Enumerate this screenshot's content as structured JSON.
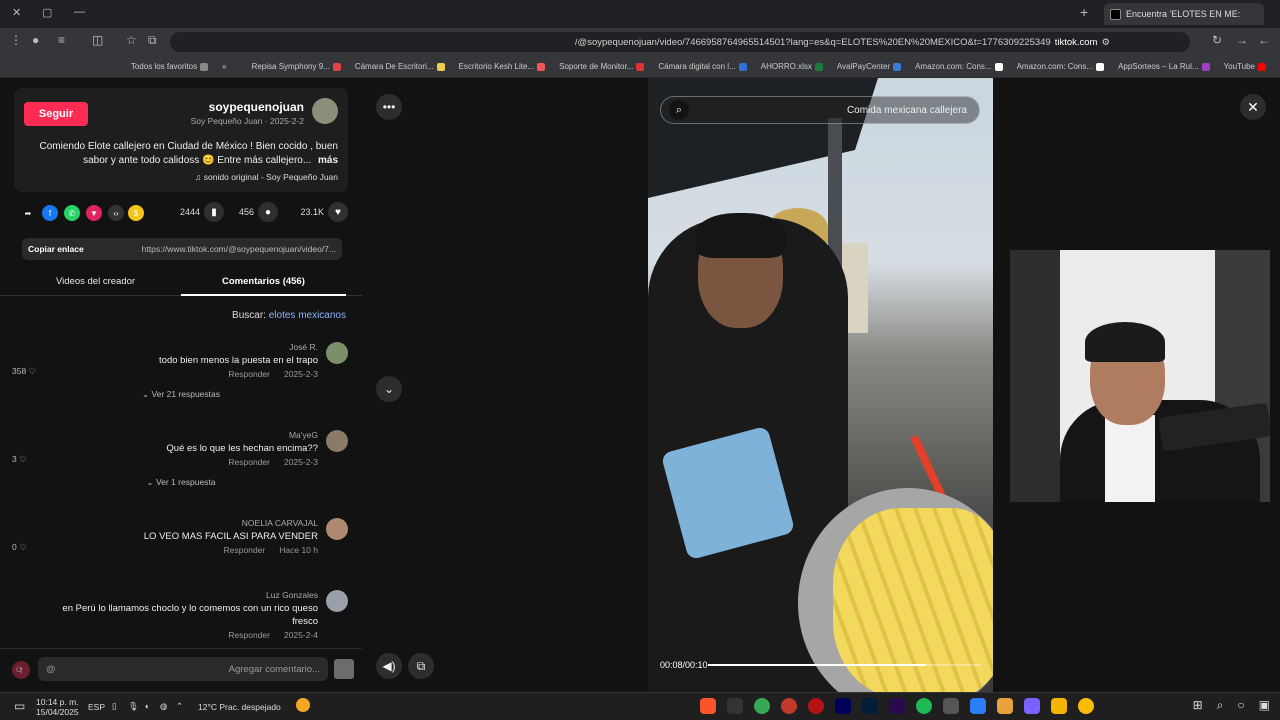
{
  "browser": {
    "tab_title": "Encuentra 'ELOTES EN ME:",
    "url_host": "tiktok.com",
    "url_path": "/@soypequenojuan/video/7466958764965514501?lang=es&q=ELOTES%20EN%20MEXICO&t=1776309225349"
  },
  "bookmarks": [
    {
      "label": "YouTube",
      "color": "#ff0000"
    },
    {
      "label": "AppSorteos – La Rul...",
      "color": "#a040c0"
    },
    {
      "label": "Amazon.com: Cons...",
      "color": "#ffffff"
    },
    {
      "label": "Amazon.com: Cons...",
      "color": "#ffffff"
    },
    {
      "label": "AvalPayCenter",
      "color": "#3a7bd5"
    },
    {
      "label": "AHORRO.xlsx",
      "color": "#1d7a3a"
    },
    {
      "label": "Cámara digital con l...",
      "color": "#2f6fd6"
    },
    {
      "label": "Soporte de Monitor...",
      "color": "#d33"
    },
    {
      "label": "Escritorio Kesh Lite...",
      "color": "#e55"
    },
    {
      "label": "Cámara De Escritori...",
      "color": "#f2c94c"
    },
    {
      "label": "Repisa Symphony 9...",
      "color": "#d44"
    },
    {
      "label": "»",
      "color": "transparent"
    },
    {
      "label": "Todos los favoritos",
      "color": "#888"
    }
  ],
  "post": {
    "follow_label": "Seguir",
    "username": "soypequenojuan",
    "subtitle": "Soy Pequeño Juan · 2025-2-2",
    "description": "Comiendo Elote callejero en Ciudad de México ! Bien cocido , buen sabor y ante todo calidoss 😊 Entre más callejero...",
    "more": "más",
    "sound": "sonido original - Soy Pequeño Juan",
    "likes": "23.1K",
    "comments_count": "456",
    "saves": "2444",
    "link": "https://www.tiktok.com/@soypequenojuan/video/7...",
    "copy_label": "Copiar enlace"
  },
  "tabs": {
    "comments": "Comentarios (456)",
    "creator_videos": "Videos del creador"
  },
  "search_hint": {
    "prefix": "Buscar:",
    "keyword": "elotes mexicanos"
  },
  "comments": [
    {
      "author": "José R.",
      "text": "todo bien menos la puesta en el trapo",
      "date": "2025-2-3",
      "reply": "Responder",
      "likes": "358",
      "replies": "Ver 21 respuestas",
      "avatar_color": "#7a8f6a"
    },
    {
      "author": "Ma'yeG",
      "text": "Qué es lo que les hechan encima??",
      "date": "2025-2-3",
      "reply": "Responder",
      "likes": "3",
      "replies": "Ver 1 respuesta",
      "avatar_color": "#8a7a66"
    },
    {
      "author": "NOELIA CARVAJAL",
      "text": "LO VEO MAS FACIL ASI PARA VENDER",
      "date": "Hace 10 h",
      "reply": "Responder",
      "likes": "0",
      "replies": "",
      "avatar_color": "#b08a70"
    },
    {
      "author": "Luz Gonzales",
      "text": "en Perú lo llamamos choclo y lo comemos con un rico queso fresco",
      "date": "2025-2-4",
      "reply": "Responder",
      "likes": "",
      "replies": "",
      "avatar_color": "#9aa0aa"
    }
  ],
  "composer": {
    "placeholder": "Agregar comentario..."
  },
  "video": {
    "search_text": "Comida mexicana callejera",
    "time": "00:08/00:10",
    "progress": 0.8
  },
  "taskbar": {
    "time": "10:14 p. m.",
    "date": "15/04/2025",
    "lang": "ESP",
    "weather": "12°C  Prac. despejado"
  }
}
